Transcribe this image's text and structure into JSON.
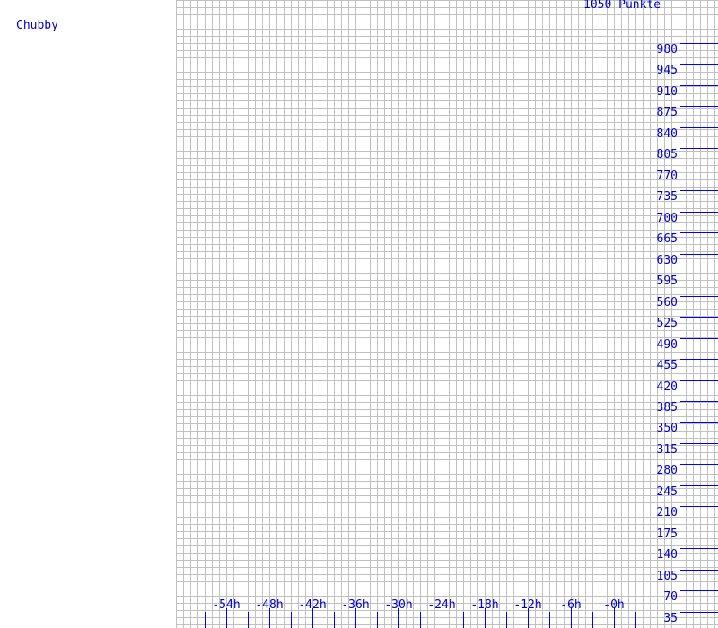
{
  "legend": {
    "series_label": "Chubby"
  },
  "chart_data": {
    "type": "line",
    "title": "1050 Punkte",
    "xlabel": "",
    "ylabel": "",
    "series": [
      {
        "name": "Chubby",
        "color": "#0000cc",
        "values": []
      }
    ],
    "grid": true,
    "legend_position": "left",
    "ylim": [
      0,
      1015
    ],
    "y_tick_step": 35,
    "y_ticks": [
      "980",
      "945",
      "910",
      "875",
      "840",
      "805",
      "770",
      "735",
      "700",
      "665",
      "630",
      "595",
      "560",
      "525",
      "490",
      "455",
      "420",
      "385",
      "350",
      "315",
      "280",
      "245",
      "210",
      "175",
      "140",
      "105",
      "70",
      "35"
    ],
    "xlim": [
      "-60h",
      "-0h"
    ],
    "x_tick_step": "6h",
    "x_ticks": [
      "-54h",
      "-48h",
      "-42h",
      "-36h",
      "-30h",
      "-24h",
      "-18h",
      "-12h",
      "-6h",
      "-0h"
    ],
    "minor_x_ticks_between": 1,
    "axis_color": "#0000ff",
    "grid_color": "#c0c0c0",
    "background": "#ffffff",
    "note": "Empty plot - no data points drawn in the chart area"
  }
}
